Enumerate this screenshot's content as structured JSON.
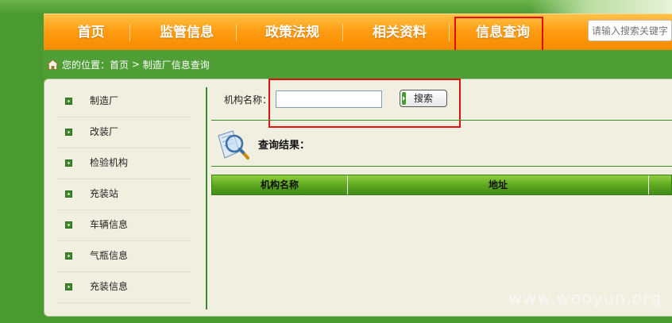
{
  "nav": {
    "items": [
      "首页",
      "监管信息",
      "政策法规",
      "相关资料",
      "信息查询"
    ],
    "search_placeholder": "请输入搜索关键字"
  },
  "breadcrumb": {
    "prefix": "您的位置：",
    "home": "首页",
    "separator": " > ",
    "current": "制造厂信息查询"
  },
  "sidebar": {
    "items": [
      "制造厂",
      "改装厂",
      "检验机构",
      "充装站",
      "车辆信息",
      "气瓶信息",
      "充装信息"
    ]
  },
  "form": {
    "org_label": "机构名称：",
    "org_value": "",
    "search_button": "搜索"
  },
  "results": {
    "title": "查询结果：",
    "columns": [
      "机构名称",
      "地址"
    ]
  },
  "watermark": "www.wooyun.org",
  "colors": {
    "nav": "#ff9d12",
    "highlight": "#e01010",
    "green": "#3a8e2a"
  }
}
